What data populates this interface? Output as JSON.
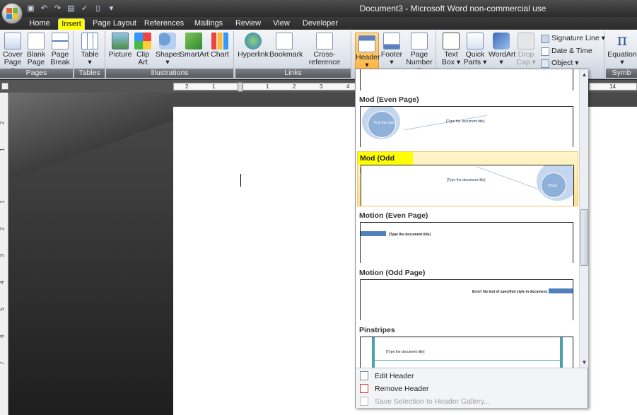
{
  "window": {
    "title": "Document3 - Microsoft Word non-commercial use"
  },
  "tabs": [
    "Home",
    "Insert",
    "Page Layout",
    "References",
    "Mailings",
    "Review",
    "View",
    "Developer"
  ],
  "active_tab": "Insert",
  "ribbon": {
    "groups": {
      "pages": "Pages",
      "tables": "Tables",
      "illustrations": "Illustrations",
      "links": "Links",
      "symbols": "Symb"
    },
    "buttons": {
      "cover_page": "Cover\nPage ▾",
      "blank_page": "Blank\nPage",
      "page_break": "Page\nBreak",
      "table": "Table\n▾",
      "picture": "Picture",
      "clip_art": "Clip\nArt",
      "shapes": "Shapes\n▾",
      "smartart": "SmartArt",
      "chart": "Chart",
      "hyperlink": "Hyperlink",
      "bookmark": "Bookmark",
      "cross_reference": "Cross-reference",
      "header": "Header\n▾",
      "footer": "Footer\n▾",
      "page_number": "Page\nNumber ▾",
      "text_box": "Text\nBox ▾",
      "quick_parts": "Quick\nParts ▾",
      "wordart": "WordArt\n▾",
      "drop_cap": "Drop\nCap ▾",
      "signature_line": "Signature Line ▾",
      "date_time": "Date & Time",
      "object": "Object ▾",
      "equation": "Equation\n▾"
    }
  },
  "ruler": {
    "left_numbers": [
      "2",
      "1",
      "1",
      "2",
      "3",
      "4"
    ],
    "right_numbers": [
      "14"
    ],
    "vertical_numbers": [
      "2",
      "1",
      "1",
      "2",
      "3",
      "4",
      "5",
      "6",
      "7"
    ]
  },
  "gallery": {
    "items": [
      {
        "title": "Mod (Even Page)",
        "thumb_text": "[Type the document title]",
        "circle_text": "Pick the date"
      },
      {
        "title": "Mod (Odd Page)",
        "thumb_text": "[Type the document title]",
        "circle_text": "[Year]"
      },
      {
        "title": "Motion (Even Page)",
        "thumb_text": "[Type the document title]"
      },
      {
        "title": "Motion (Odd Page)",
        "thumb_text": "Error! No text of specified style in document."
      },
      {
        "title": "Pinstripes",
        "thumb_text": "[Type the document title]"
      }
    ],
    "footer": {
      "edit_header": "Edit Header",
      "remove_header": "Remove Header",
      "save_selection": "Save Selection to Header Gallery..."
    }
  },
  "colors": {
    "accent_blue": "#4f81bd",
    "highlight": "#ffff00",
    "pinstripe_teal": "#4aa3a6"
  }
}
